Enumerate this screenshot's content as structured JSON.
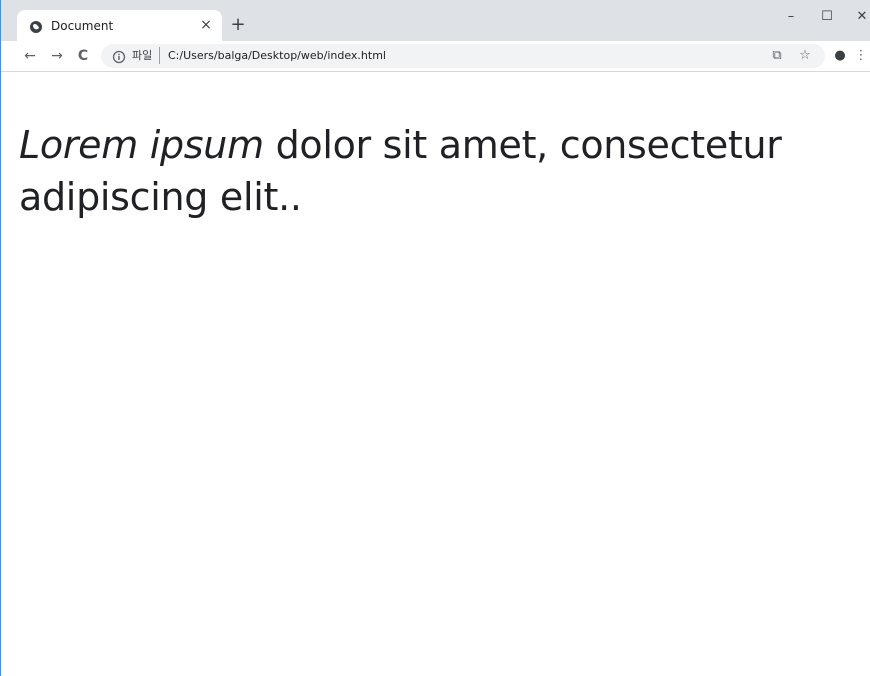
{
  "tab": {
    "title": "Document",
    "close_glyph": "×",
    "favicon": "globe-icon"
  },
  "new_tab_glyph": "+",
  "window_controls": {
    "minimize": "–",
    "maximize": "☐",
    "close": "✕"
  },
  "toolbar": {
    "back": "←",
    "forward": "→",
    "reload": "C"
  },
  "omnibox": {
    "origin_label": "파일",
    "url": "C:/Users/balga/Desktop/web/index.html",
    "translate_glyph": "⧉",
    "bookmark_glyph": "☆",
    "profile_glyph": "●",
    "menu_glyph": "⋮"
  },
  "content": {
    "emphasis": "Lorem ipsum",
    "rest": " dolor sit amet, consectetur adipiscing elit.."
  },
  "colors": {
    "tabstrip": "#dee1e6",
    "omnibox": "#f1f3f4",
    "text": "#202124"
  }
}
